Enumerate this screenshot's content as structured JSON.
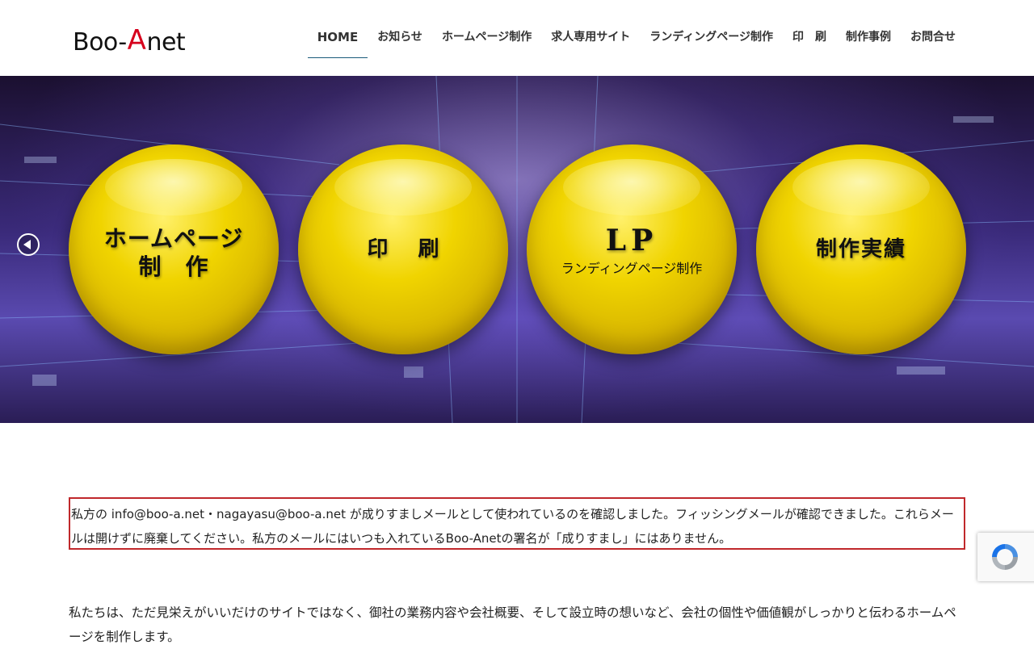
{
  "logo": {
    "part1": "Boo-",
    "part_a": "A",
    "part2": "net"
  },
  "nav": {
    "items": [
      {
        "label": "HOME"
      },
      {
        "label": "お知らせ"
      },
      {
        "label": "ホームページ制作"
      },
      {
        "label": "求人専用サイト"
      },
      {
        "label": "ランディングページ制作"
      },
      {
        "label": "印　刷"
      },
      {
        "label": "制作事例"
      },
      {
        "label": "お問合せ"
      }
    ],
    "active_index": 0
  },
  "hero": {
    "orbs": [
      {
        "line1": "ホームページ",
        "line2": "制　作"
      },
      {
        "line1": "印 刷"
      },
      {
        "line1": "LP",
        "line2": "ランディングページ制作"
      },
      {
        "line1": "制作実績"
      }
    ]
  },
  "notice": {
    "text": "私方の info@boo-a.net・nagayasu@boo-a.net が成りすましメールとして使われているのを確認しました。フィッシングメールが確認できました。これらメールは開けずに廃棄してください。私方のメールにはいつも入れているBoo-Anetの署名が「成りすまし」にはありません。"
  },
  "intro": {
    "text": "私たちは、ただ見栄えがいいだけのサイトではなく、御社の業務内容や会社概要、そして設立時の想いなど、会社の個性や価値観がしっかりと伝わるホームページを制作します。"
  },
  "icons": {
    "prev": "chevron-left-icon",
    "recaptcha": "recaptcha-icon"
  },
  "colors": {
    "nav_active_underline": "#1a5b7a",
    "notice_border": "#c0282b",
    "orb_yellow": "#f0d400"
  }
}
